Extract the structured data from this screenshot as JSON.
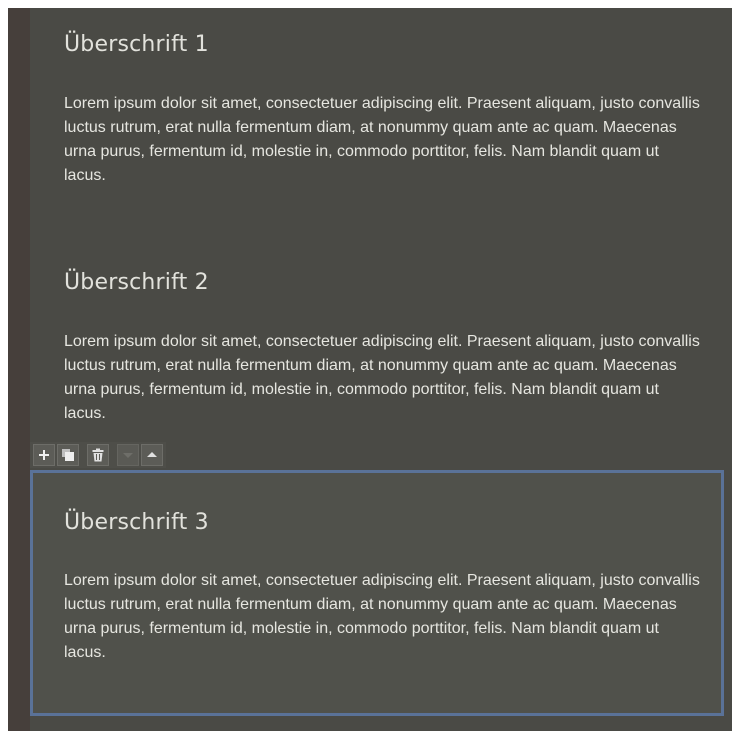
{
  "sections": [
    {
      "heading": "Überschrift 1",
      "text": "Lorem ipsum dolor sit amet, consectetuer adipiscing elit. Praesent aliquam, justo convallis luctus rutrum, erat nulla fermentum diam, at nonummy quam ante ac quam. Maecenas urna purus, fermentum id, molestie in, commodo porttitor, felis. Nam blandit quam ut lacus."
    },
    {
      "heading": "Überschrift 2",
      "text": "Lorem ipsum dolor sit amet, consectetuer adipiscing elit. Praesent aliquam, justo convallis luctus rutrum, erat nulla fermentum diam, at nonummy quam ante ac quam. Maecenas urna purus, fermentum id, molestie in, commodo porttitor, felis. Nam blandit quam ut lacus."
    },
    {
      "heading": "Überschrift 3",
      "text": "Lorem ipsum dolor sit amet, consectetuer adipiscing elit. Praesent aliquam, justo convallis luctus rutrum, erat nulla fermentum diam, at nonummy quam ante ac quam. Maecenas urna purus, fermentum id, molestie in, commodo porttitor, felis. Nam blandit quam ut lacus.",
      "selected": true
    }
  ],
  "toolbar": {
    "buttons": [
      {
        "icon": "plus-icon",
        "enabled": true
      },
      {
        "icon": "copy-icon",
        "enabled": true
      },
      {
        "icon": "trash-icon",
        "enabled": true
      },
      {
        "icon": "chevron-down-icon",
        "enabled": false
      },
      {
        "icon": "chevron-up-icon",
        "enabled": true
      }
    ]
  },
  "colors": {
    "background": "#4a4a45",
    "selection_border": "#5a7298",
    "text": "#e6e6e0"
  }
}
